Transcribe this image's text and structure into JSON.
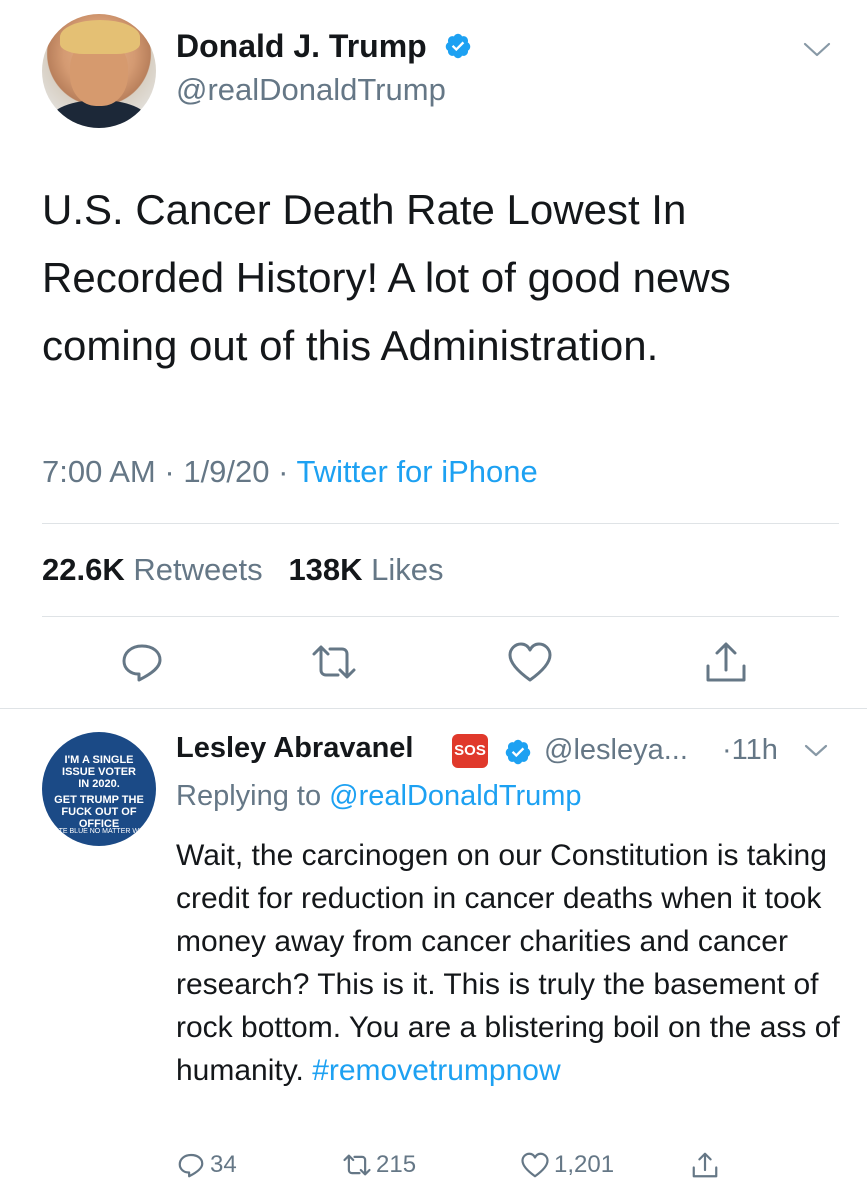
{
  "tweet": {
    "author_name": "Donald J. Trump",
    "handle": "@realDonaldTrump",
    "text": "U.S. Cancer Death Rate Lowest In Recorded History! A lot of good news coming out of this Administration.",
    "time": "7:00 AM",
    "date": "1/9/20",
    "separator": "·",
    "source": "Twitter for iPhone",
    "retweets_count": "22.6K",
    "retweets_label": "Retweets",
    "likes_count": "138K",
    "likes_label": "Likes",
    "actions": [
      "reply-icon",
      "retweet-icon",
      "like-icon",
      "share-icon"
    ]
  },
  "reply": {
    "author_name": "Lesley Abravanel",
    "sos_badge": "SOS",
    "handle": "@lesleya...",
    "time": "·11h",
    "replying_prefix": "Replying to",
    "replying_to": "@realDonaldTrump",
    "text": "Wait, the carcinogen on our Constitution is taking credit for reduction in cancer deaths when it took money away from cancer charities and cancer research? This is it. This is truly the basement of rock bottom. You are a blistering boil on the ass of humanity.",
    "hashtag": "#removetrumpnow",
    "avatar_badge": {
      "line1": "I'M A SINGLE",
      "line2": "ISSUE VOTER",
      "line3": "IN 2020.",
      "line4": "GET TRUMP THE",
      "line5": "FUCK OUT OF",
      "line6": "OFFICE",
      "ring": "VOTE BLUE NO MATTER WHO"
    },
    "reply_count": "34",
    "retweet_count": "215",
    "like_count": "1,201"
  },
  "colors": {
    "accent": "#1da1f2",
    "text": "#14171a",
    "muted": "#657786",
    "divider": "#dfe3e6",
    "sos_red": "#e0392b"
  }
}
